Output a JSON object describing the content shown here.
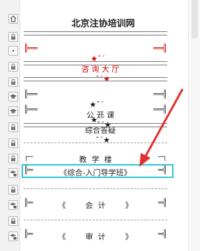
{
  "title": "北京注协培训网",
  "menu": {
    "lobby_prefix": "★",
    "lobby_label": "咨 询 大 厅",
    "lobby_suffix": "★",
    "public_label": "公 开 课",
    "qa_label": "综合答疑",
    "building_label": "教  学  楼",
    "course_intro": "《综合-入门导学班》",
    "course_accounting": "《        会  计        》",
    "course_audit": "《        审  计        》"
  },
  "icons": [
    "home-icon",
    "lock-icon",
    "dot-icon",
    "lock-icon",
    "lock-icon",
    "graduation-cap-icon",
    "graduation-cap-icon",
    "lock-icon",
    "lock-icon",
    "lock-icon",
    "graduation-cap-lock-icon",
    "lock-icon",
    "graduation-cap-lock-icon",
    "lock-icon",
    "graduation-cap-lock-icon"
  ],
  "colors": {
    "highlight": "#2fc6d4",
    "lobby_text": "#d40000",
    "arrow": "#e03030"
  }
}
